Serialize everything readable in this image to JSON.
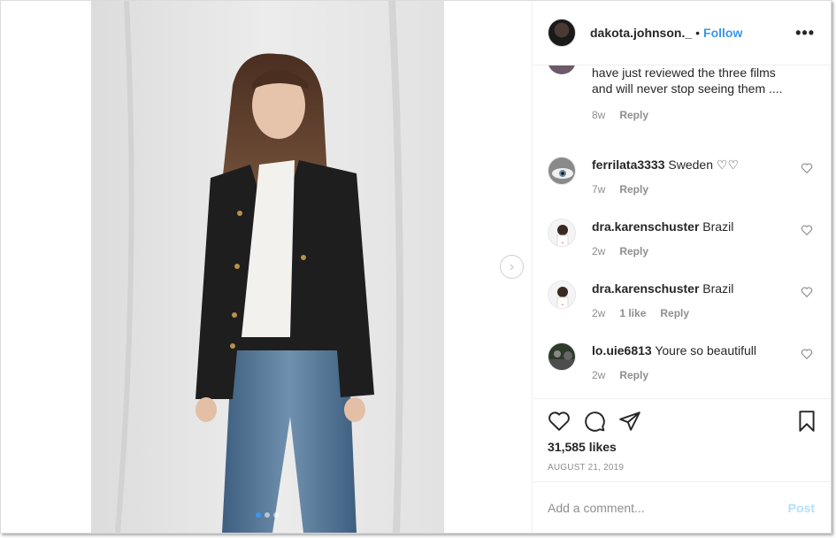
{
  "post": {
    "username": "dakota.johnson._",
    "separator": "•",
    "follow_label": "Follow",
    "more_label": "•••"
  },
  "media": {
    "next_arrow": "›",
    "dots_count": 3,
    "active_dot": 0
  },
  "comments": {
    "partial": {
      "text": "have just reviewed the three films and will never stop seeing them ....",
      "time": "8w",
      "reply_label": "Reply"
    },
    "items": [
      {
        "user": "ferrilata3333",
        "text": "Sweden ♡♡",
        "time": "7w",
        "likes": "",
        "reply_label": "Reply"
      },
      {
        "user": "dra.karenschuster",
        "text": "Brazil",
        "time": "2w",
        "likes": "",
        "reply_label": "Reply"
      },
      {
        "user": "dra.karenschuster",
        "text": "Brazil",
        "time": "2w",
        "likes": "1 like",
        "reply_label": "Reply"
      },
      {
        "user": "lo.uie6813",
        "text": "Youre so beautifull",
        "time": "2w",
        "likes": "",
        "reply_label": "Reply"
      }
    ]
  },
  "actions": {
    "like_icon": "heart-icon",
    "comment_icon": "comment-icon",
    "share_icon": "share-icon",
    "save_icon": "bookmark-icon"
  },
  "likes_text": "31,585 likes",
  "date": "AUGUST 21, 2019",
  "add_comment": {
    "placeholder": "Add a comment...",
    "post_label": "Post"
  },
  "colors": {
    "link_blue": "#3897f0",
    "post_disabled": "#b2dffc",
    "text": "#262626",
    "muted": "#8e8e8e"
  }
}
